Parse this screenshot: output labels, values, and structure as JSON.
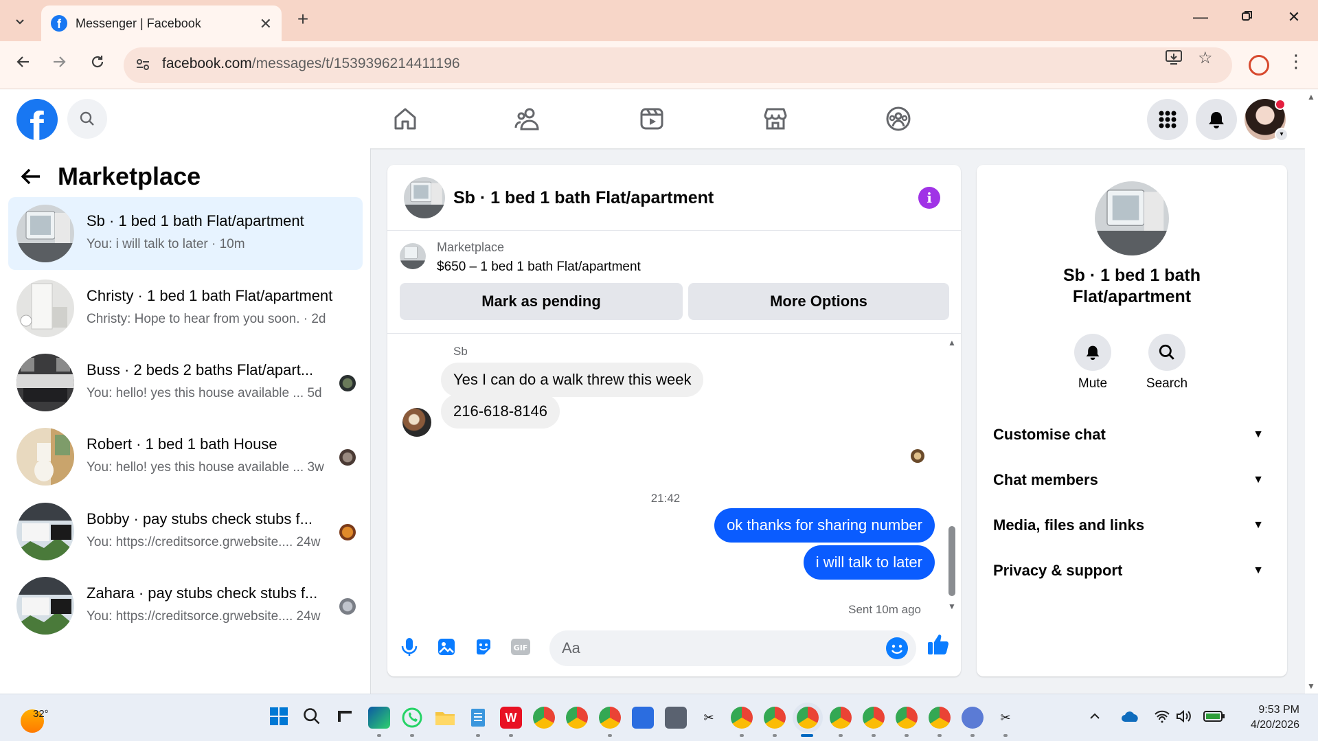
{
  "browser": {
    "tab_title": "Messenger | Facebook",
    "url_domain": "facebook.com",
    "url_path": "/messages/t/1539396214411196"
  },
  "sidebar": {
    "title": "Marketplace",
    "conversations": [
      {
        "name": "Sb · 1 bed 1 bath Flat/apartment",
        "preview": "You: i will talk to later · 10m",
        "active": true
      },
      {
        "name": "Christy · 1 bed 1 bath Flat/apartment",
        "preview": "Christy: Hope to hear from you soon. · 2d"
      },
      {
        "name": "Buss · 2 beds 2 baths Flat/apart...",
        "preview": "You: hello! yes this house available ...  5d"
      },
      {
        "name": "Robert · 1 bed 1 bath House",
        "preview": "You: hello! yes this house available ...  3w"
      },
      {
        "name": "Bobby · pay stubs check stubs f...",
        "preview": "You: https://creditsorce.grwebsite....  24w"
      },
      {
        "name": "Zahara · pay stubs check stubs f...",
        "preview": "You: https://creditsorce.grwebsite....  24w"
      }
    ]
  },
  "chat": {
    "title": "Sb · 1 bed 1 bath Flat/apartment",
    "marketplace_label": "Marketplace",
    "listing": "$650 – 1 bed 1 bath Flat/apartment",
    "mark_pending": "Mark as pending",
    "more_options": "More Options",
    "sender": "Sb",
    "incoming": [
      "Yes I can do a walk threw this week",
      "216-618-8146"
    ],
    "timestamp": "21:42",
    "outgoing": [
      "ok thanks for sharing number",
      "i will talk to later"
    ],
    "sent_meta": "Sent 10m ago",
    "composer_placeholder": "Aa"
  },
  "right_panel": {
    "name_line1": "Sb · 1 bed 1 bath",
    "name_line2": "Flat/apartment",
    "mute": "Mute",
    "search": "Search",
    "sections": [
      "Customise chat",
      "Chat members",
      "Media, files and links",
      "Privacy & support"
    ]
  },
  "taskbar": {
    "temperature": "32°",
    "time": "9:53 PM",
    "date": "4/20/2026"
  },
  "colors": {
    "facebook_blue": "#1877f2",
    "messenger_bubble": "#0a5cff",
    "info_purple": "#a033e6",
    "active_row": "#e7f3ff"
  }
}
